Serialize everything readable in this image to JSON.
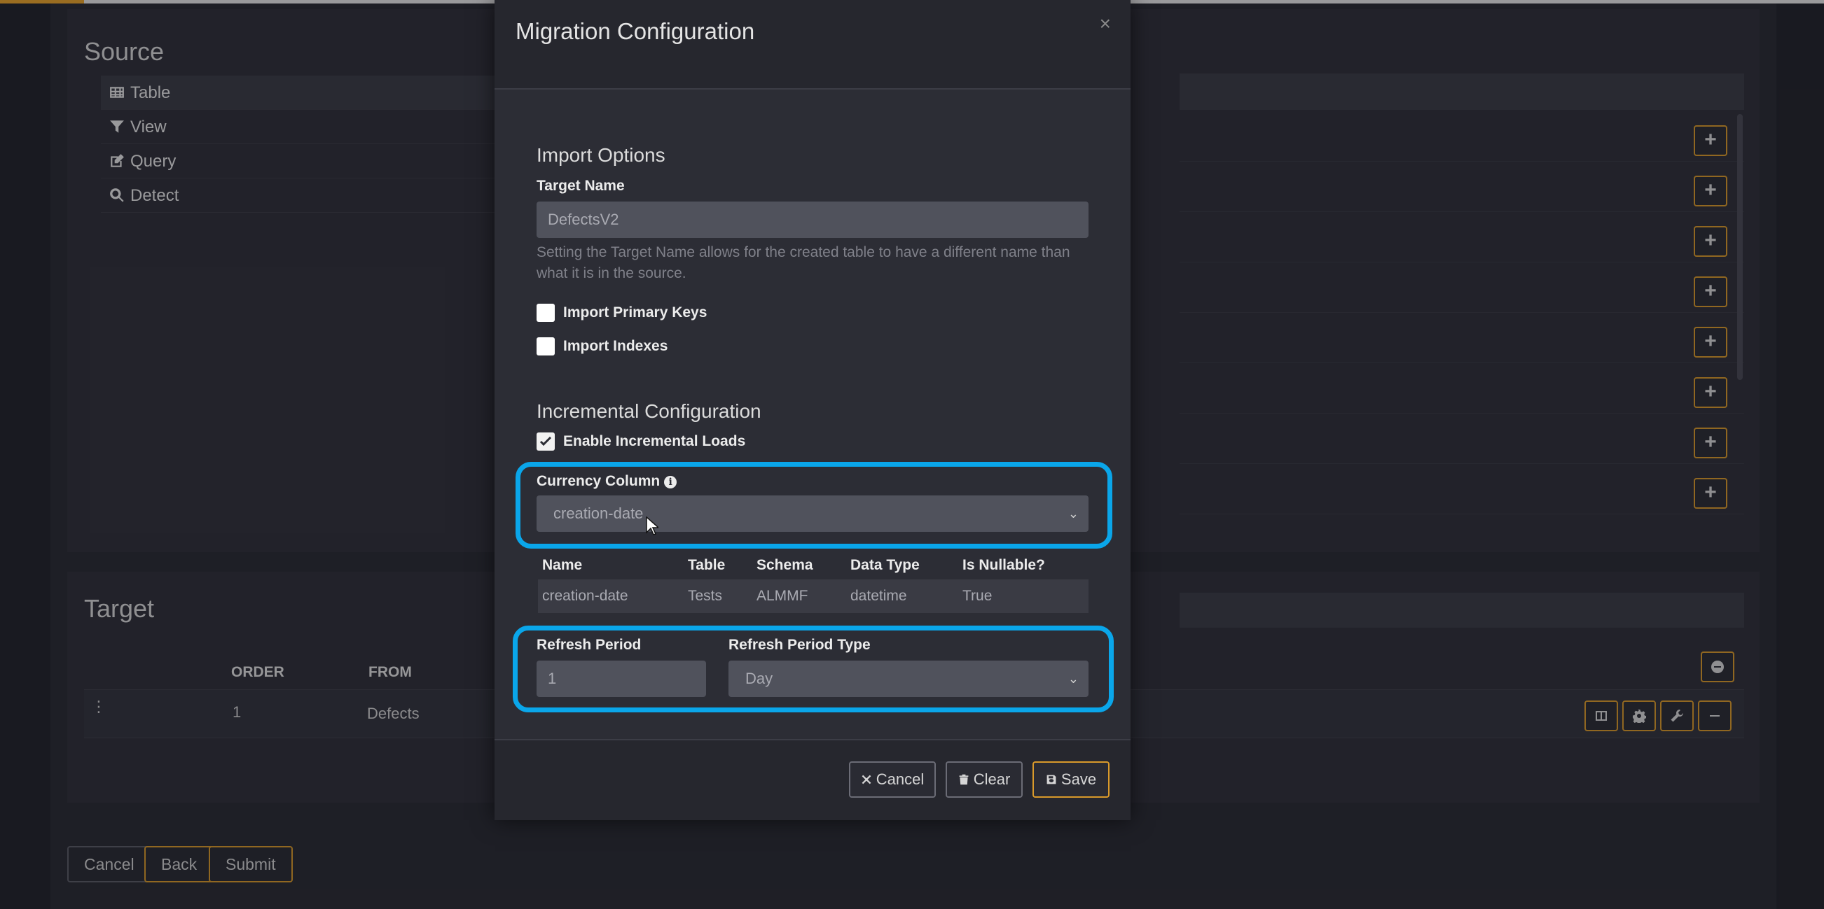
{
  "source": {
    "title": "Source",
    "items": [
      {
        "label": "Table",
        "icon": "table-icon"
      },
      {
        "label": "View",
        "icon": "filter-icon"
      },
      {
        "label": "Query",
        "icon": "edit-icon"
      },
      {
        "label": "Detect",
        "icon": "search-icon"
      }
    ]
  },
  "target": {
    "title": "Target",
    "columns": [
      "ORDER",
      "FROM"
    ],
    "rows": [
      {
        "order": "1",
        "from": "Defects"
      }
    ]
  },
  "footer": {
    "cancel": "Cancel",
    "back": "Back",
    "submit": "Submit"
  },
  "modal": {
    "title": "Migration Configuration",
    "close": "×",
    "import_options": {
      "title": "Import Options",
      "target_name_label": "Target Name",
      "target_name_value": "DefectsV2",
      "help": "Setting the Target Name allows for the created table to have a different name than what it is in the source.",
      "import_primary_keys": "Import Primary Keys",
      "import_indexes": "Import Indexes"
    },
    "incremental": {
      "title": "Incremental Configuration",
      "enable_label": "Enable Incremental Loads",
      "currency_column_label": "Currency Column",
      "currency_column_value": "creation-date",
      "columns": [
        "Name",
        "Table",
        "Schema",
        "Data Type",
        "Is Nullable?"
      ],
      "row": [
        "creation-date",
        "Tests",
        "ALMMF",
        "datetime",
        "True"
      ],
      "refresh_period_label": "Refresh Period",
      "refresh_period_value": "1",
      "refresh_period_type_label": "Refresh Period Type",
      "refresh_period_type_value": "Day"
    },
    "buttons": {
      "cancel": "Cancel",
      "clear": "Clear",
      "save": "Save"
    }
  },
  "colors": {
    "accent": "#d99a2b",
    "highlight": "#0aa6ea"
  }
}
